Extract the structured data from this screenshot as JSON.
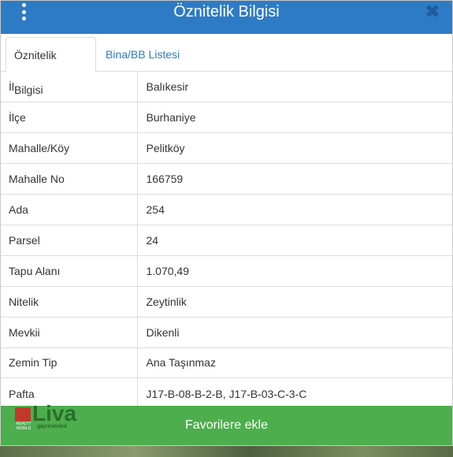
{
  "header": {
    "title": "Öznitelik Bilgisi",
    "close_symbol": "✖"
  },
  "tabs": [
    {
      "label": "Öznitelik Bilgisi",
      "active": true
    },
    {
      "label": "Bina/BB Listesi",
      "active": false
    }
  ],
  "attributes": [
    {
      "key": "İl",
      "value": "Balıkesir"
    },
    {
      "key": "İlçe",
      "value": "Burhaniye"
    },
    {
      "key": "Mahalle/Köy",
      "value": "Pelitköy"
    },
    {
      "key": "Mahalle No",
      "value": "166759"
    },
    {
      "key": "Ada",
      "value": "254"
    },
    {
      "key": "Parsel",
      "value": "24"
    },
    {
      "key": "Tapu Alanı",
      "value": "1.070,49"
    },
    {
      "key": "Nitelik",
      "value": "Zeytinlik"
    },
    {
      "key": "Mevkii",
      "value": "Dikenli"
    },
    {
      "key": "Zemin Tip",
      "value": "Ana Taşınmaz"
    },
    {
      "key": "Pafta",
      "value": "J17-B-08-B-2-B, J17-B-03-C-3-C"
    }
  ],
  "footer": {
    "button_label": "Favorilere ekle"
  },
  "logo": {
    "word": "Liva",
    "sub": "gayrimenkul",
    "small": "REALTY WORLD"
  },
  "colors": {
    "header": "#2e7bc5",
    "footer": "#4cae4c",
    "tab_link": "#2e7bc5"
  }
}
